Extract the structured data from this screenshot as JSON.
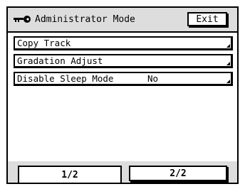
{
  "header": {
    "title": "Administrator Mode",
    "icon": "key-icon",
    "exit_label": "Exit"
  },
  "menu": {
    "items": [
      {
        "label": "Copy Track",
        "value": ""
      },
      {
        "label": "Gradation Adjust",
        "value": ""
      },
      {
        "label": "Disable Sleep Mode",
        "value": "No"
      }
    ]
  },
  "pager": {
    "tabs": [
      {
        "label": "1/2",
        "active": true
      },
      {
        "label": "2/2",
        "active": false
      }
    ]
  }
}
